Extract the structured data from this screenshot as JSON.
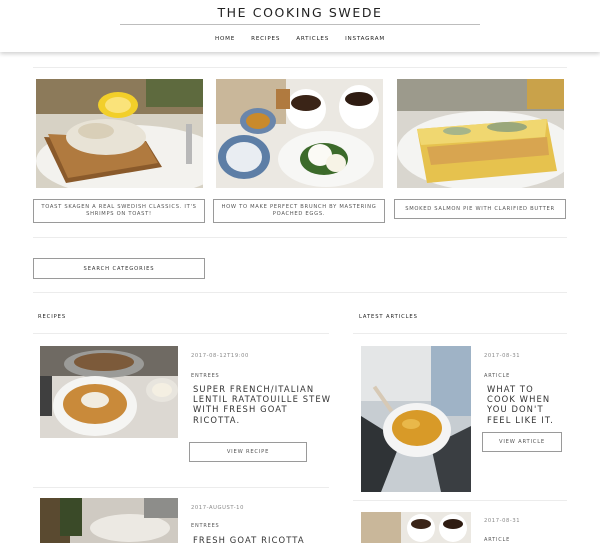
{
  "site": {
    "title": "THE COOKING SWEDE"
  },
  "nav": {
    "items": [
      "HOME",
      "RECIPES",
      "ARTICLES",
      "INSTAGRAM"
    ]
  },
  "featured": [
    {
      "caption": "TOAST SKAGEN A REAL SWEDISH CLASSICS. IT'S SHRIMPS ON TOAST!"
    },
    {
      "caption": "HOW TO MAKE PERFECT BRUNCH BY MASTERING POACHED EGGS."
    },
    {
      "caption": "SMOKED SALMON PIE WITH CLARIFIED BUTTER"
    }
  ],
  "search": {
    "label": "SEARCH CATEGORIES"
  },
  "recipes": {
    "heading": "RECIPES",
    "posts": [
      {
        "date": "2017-08-12T19:00",
        "category": "ENTREES",
        "title": "SUPER FRENCH/ITALIAN LENTIL RATATOUILLE STEW WITH FRESH GOAT RICOTTA.",
        "button": "VIEW RECIPE"
      },
      {
        "date": "2017-AUGUST-10",
        "category": "ENTREES",
        "title": "FRESH GOAT RICOTTA"
      }
    ]
  },
  "articles": {
    "heading": "LATEST ARTICLES",
    "posts": [
      {
        "date": "2017-08-31",
        "category": "ARTICLE",
        "title": "WHAT TO COOK WHEN YOU DON'T FEEL LIKE IT.",
        "button": "VIEW ARTICLE"
      },
      {
        "date": "2017-08-31",
        "category": "ARTICLE"
      }
    ]
  }
}
